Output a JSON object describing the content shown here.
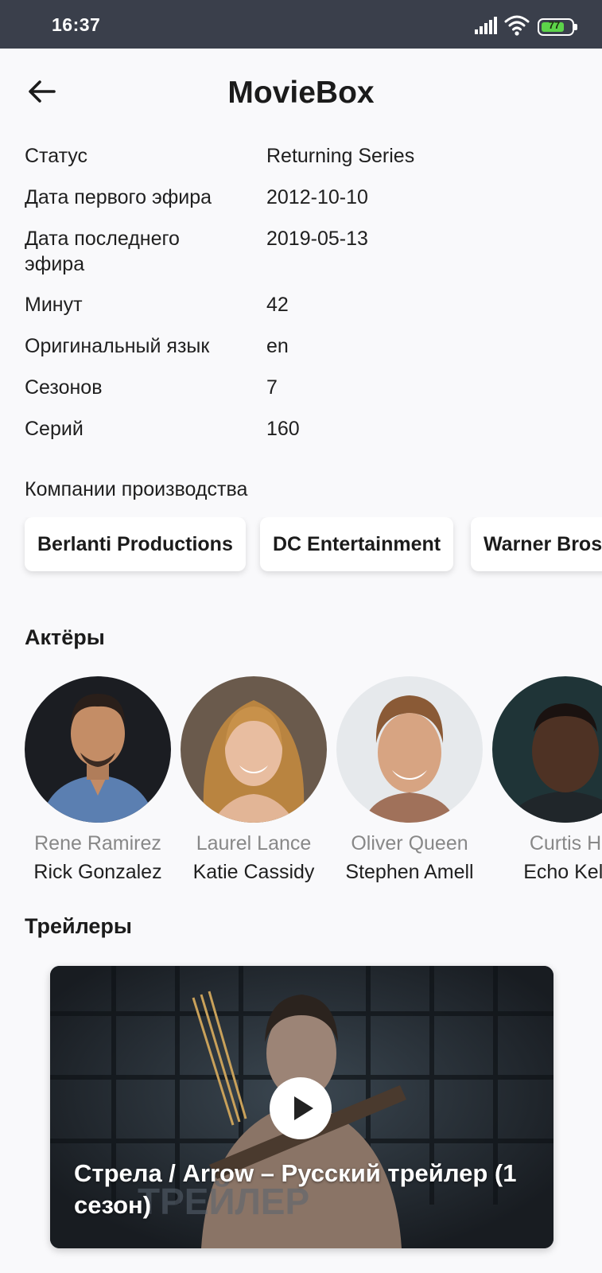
{
  "status_bar": {
    "time": "16:37",
    "battery_level": "77",
    "battery_fraction": 0.77,
    "icons": [
      "signal-icon",
      "wifi-icon",
      "battery-icon"
    ]
  },
  "header": {
    "back_icon": "arrow-left-icon",
    "title": "MovieBox"
  },
  "info": [
    {
      "label": "Статус",
      "value": "Returning Series"
    },
    {
      "label": "Дата первого эфира",
      "value": "2012-10-10"
    },
    {
      "label": "Дата последнего эфира",
      "value": "2019-05-13"
    },
    {
      "label": "Минут",
      "value": "42"
    },
    {
      "label": "Оригинальный язык",
      "value": "en"
    },
    {
      "label": "Сезонов",
      "value": "7"
    },
    {
      "label": "Серий",
      "value": "160"
    }
  ],
  "companies": {
    "title": "Компании производства",
    "items": [
      "Berlanti Productions",
      "DC Entertainment",
      "Warner Bros"
    ]
  },
  "actors": {
    "title": "Актёры",
    "items": [
      {
        "character": "Rene Ramirez",
        "name": "Rick Gonzalez"
      },
      {
        "character": "Laurel Lance",
        "name": "Katie Cassidy"
      },
      {
        "character": "Oliver Queen",
        "name": "Stephen Amell"
      },
      {
        "character": "Curtis H",
        "name": "Echo Kell"
      }
    ]
  },
  "trailers": {
    "title": "Трейлеры",
    "items": [
      {
        "title": "Стрела / Arrow – Русский трейлер (1 сезон)",
        "watermark": "ТРЕЙЛЕР",
        "play_icon": "play-icon"
      }
    ]
  },
  "colors": {
    "status_bar_bg": "#3a3f4b",
    "background": "#f9f9fb",
    "battery_fill": "#5cd44a",
    "secondary_text": "#888888"
  }
}
